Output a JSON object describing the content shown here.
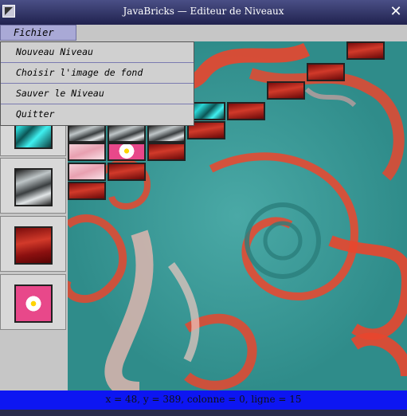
{
  "window": {
    "title": "JavaBricks  — Editeur de Niveaux",
    "close_glyph": "✕"
  },
  "menubar": {
    "fichier": "Fichier"
  },
  "menu": {
    "items": [
      "Nouveau Niveau",
      "Choisir l'image de fond",
      "Sauver le Niveau",
      "Quitter"
    ]
  },
  "palette": {
    "tiles": [
      "red-brick-tile",
      "teal-brick-tile",
      "grey-brick-tile",
      "dark-red-brick-tile",
      "pink-flower-brick-tile"
    ]
  },
  "status": {
    "text": "x = 48, y = 389, colonne = 0, ligne = 15"
  },
  "colors": {
    "status_bar": "#0d16f2",
    "menu_highlight": "#a9a9d6",
    "background_teal": "#3a9c9a",
    "background_red": "#e8462e"
  }
}
